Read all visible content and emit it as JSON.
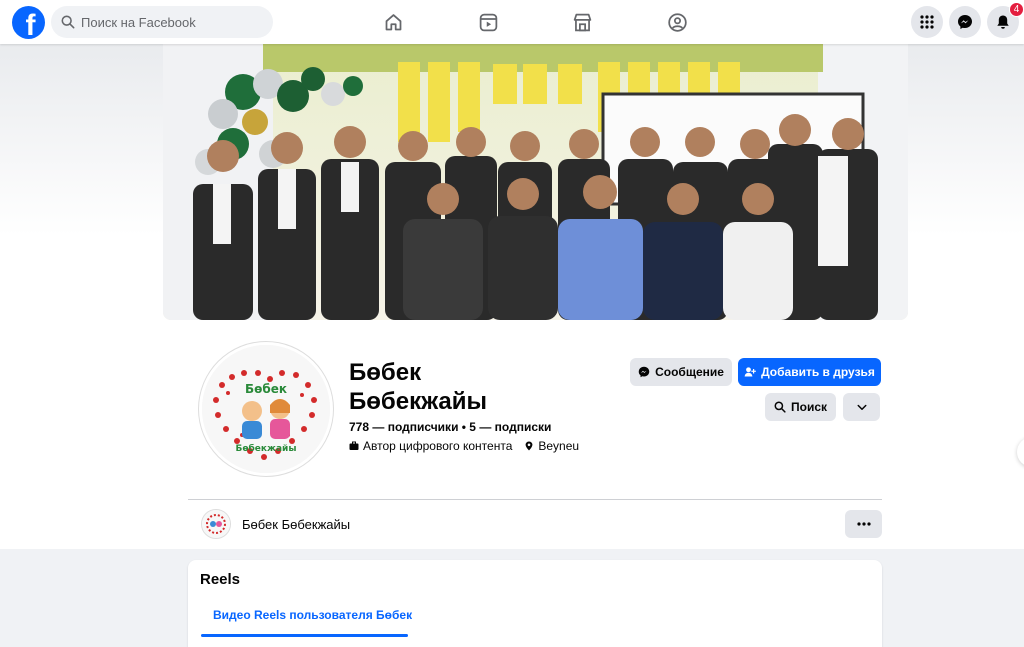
{
  "topbar": {
    "search_placeholder": "Поиск на Facebook",
    "notification_count": "4"
  },
  "profile": {
    "name_line1": "Бөбек",
    "name_line2": "Бөбекжайы",
    "stats": "778 — подписчики • 5 — подписки",
    "category": "Автор цифрового контента",
    "location": "Beyneu",
    "logo_text_top": "Бөбек",
    "logo_text_bottom": "Бөбекжайы"
  },
  "actions": {
    "message_label": "Сообщение",
    "add_friend_label": "Добавить в друзья",
    "search_label": "Поиск"
  },
  "subheader": {
    "name": "Бөбек Бөбекжайы"
  },
  "reels": {
    "title": "Reels",
    "tab_label": "Видео Reels пользователя Бөбек"
  },
  "colors": {
    "brand_blue": "#0866ff",
    "notification_red": "#e41e3f",
    "button_gray": "#e4e6eb"
  }
}
